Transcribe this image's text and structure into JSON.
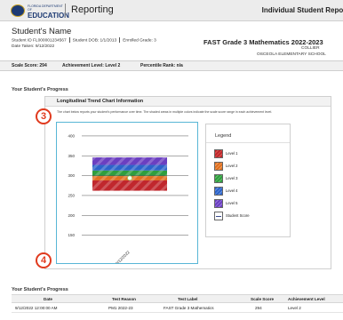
{
  "header": {
    "logo_line1": "FLORIDA DEPARTMENT OF",
    "logo_line2": "EDUCATION",
    "app_title": "Reporting",
    "report_title": "Individual Student Report"
  },
  "student": {
    "name": "Student's Name",
    "id_text": "Student ID FL000001234567",
    "dob_text": "Student DOB: 1/1/2013",
    "grade_text": "Enrolled Grade: 3",
    "date_taken": "Date Taken: 9/12/2022",
    "assessment_title": "FAST Grade 3 Mathematics 2022-2023",
    "district": "COLLIER",
    "school": "OSCEOLA ELEMENTARY SCHOOL"
  },
  "summary": {
    "scale_score": "Scale Score: 294",
    "achievement_level": "Achievement Level: Level 2",
    "percentile_rank": "Percentile Rank: n/a"
  },
  "progress_section": {
    "title": "Your Student's Progress",
    "chart_title": "Longitudinal Trend Chart Information",
    "chart_description": "The chart below reports your student's performance over time. The shaded areas in multiple colors indicate the scale score range in each achievement level."
  },
  "chart_data": {
    "type": "area",
    "ylim": [
      120,
      420
    ],
    "y_ticks": [
      "400",
      "350",
      "300",
      "250",
      "200",
      "150"
    ],
    "x_ticks": [
      "9/12/2022"
    ],
    "bands": [
      {
        "level": "Level 1",
        "from": 262,
        "to": 288,
        "color": "#c0272d"
      },
      {
        "level": "Level 2",
        "from": 288,
        "to": 299,
        "color": "#e07020"
      },
      {
        "level": "Level 3",
        "from": 299,
        "to": 313,
        "color": "#2f9e3e"
      },
      {
        "level": "Level 4",
        "from": 313,
        "to": 327,
        "color": "#2c63c9"
      },
      {
        "level": "Level 5",
        "from": 327,
        "to": 346,
        "color": "#6b3fc0"
      }
    ],
    "series": [
      {
        "name": "Student Score",
        "points": [
          {
            "x": "9/12/2022",
            "y": 294
          }
        ]
      }
    ]
  },
  "legend": {
    "title": "Legend",
    "items": [
      {
        "label": "Level 1"
      },
      {
        "label": "Level 2"
      },
      {
        "label": "Level 3"
      },
      {
        "label": "Level 4"
      },
      {
        "label": "Level 5"
      },
      {
        "label": "Student Score"
      }
    ]
  },
  "markers": {
    "m3": "3",
    "m4": "4"
  },
  "table": {
    "title": "Your Student's Progress",
    "headers": [
      "Date",
      "Test Reason",
      "Test Label",
      "Scale Score",
      "Achievement Level"
    ],
    "rows": [
      [
        "9/12/2022 12:00:00 AM",
        "PM1 2022-23",
        "FAST Grade 3 Mathematics",
        "294",
        "Level 2"
      ]
    ]
  }
}
